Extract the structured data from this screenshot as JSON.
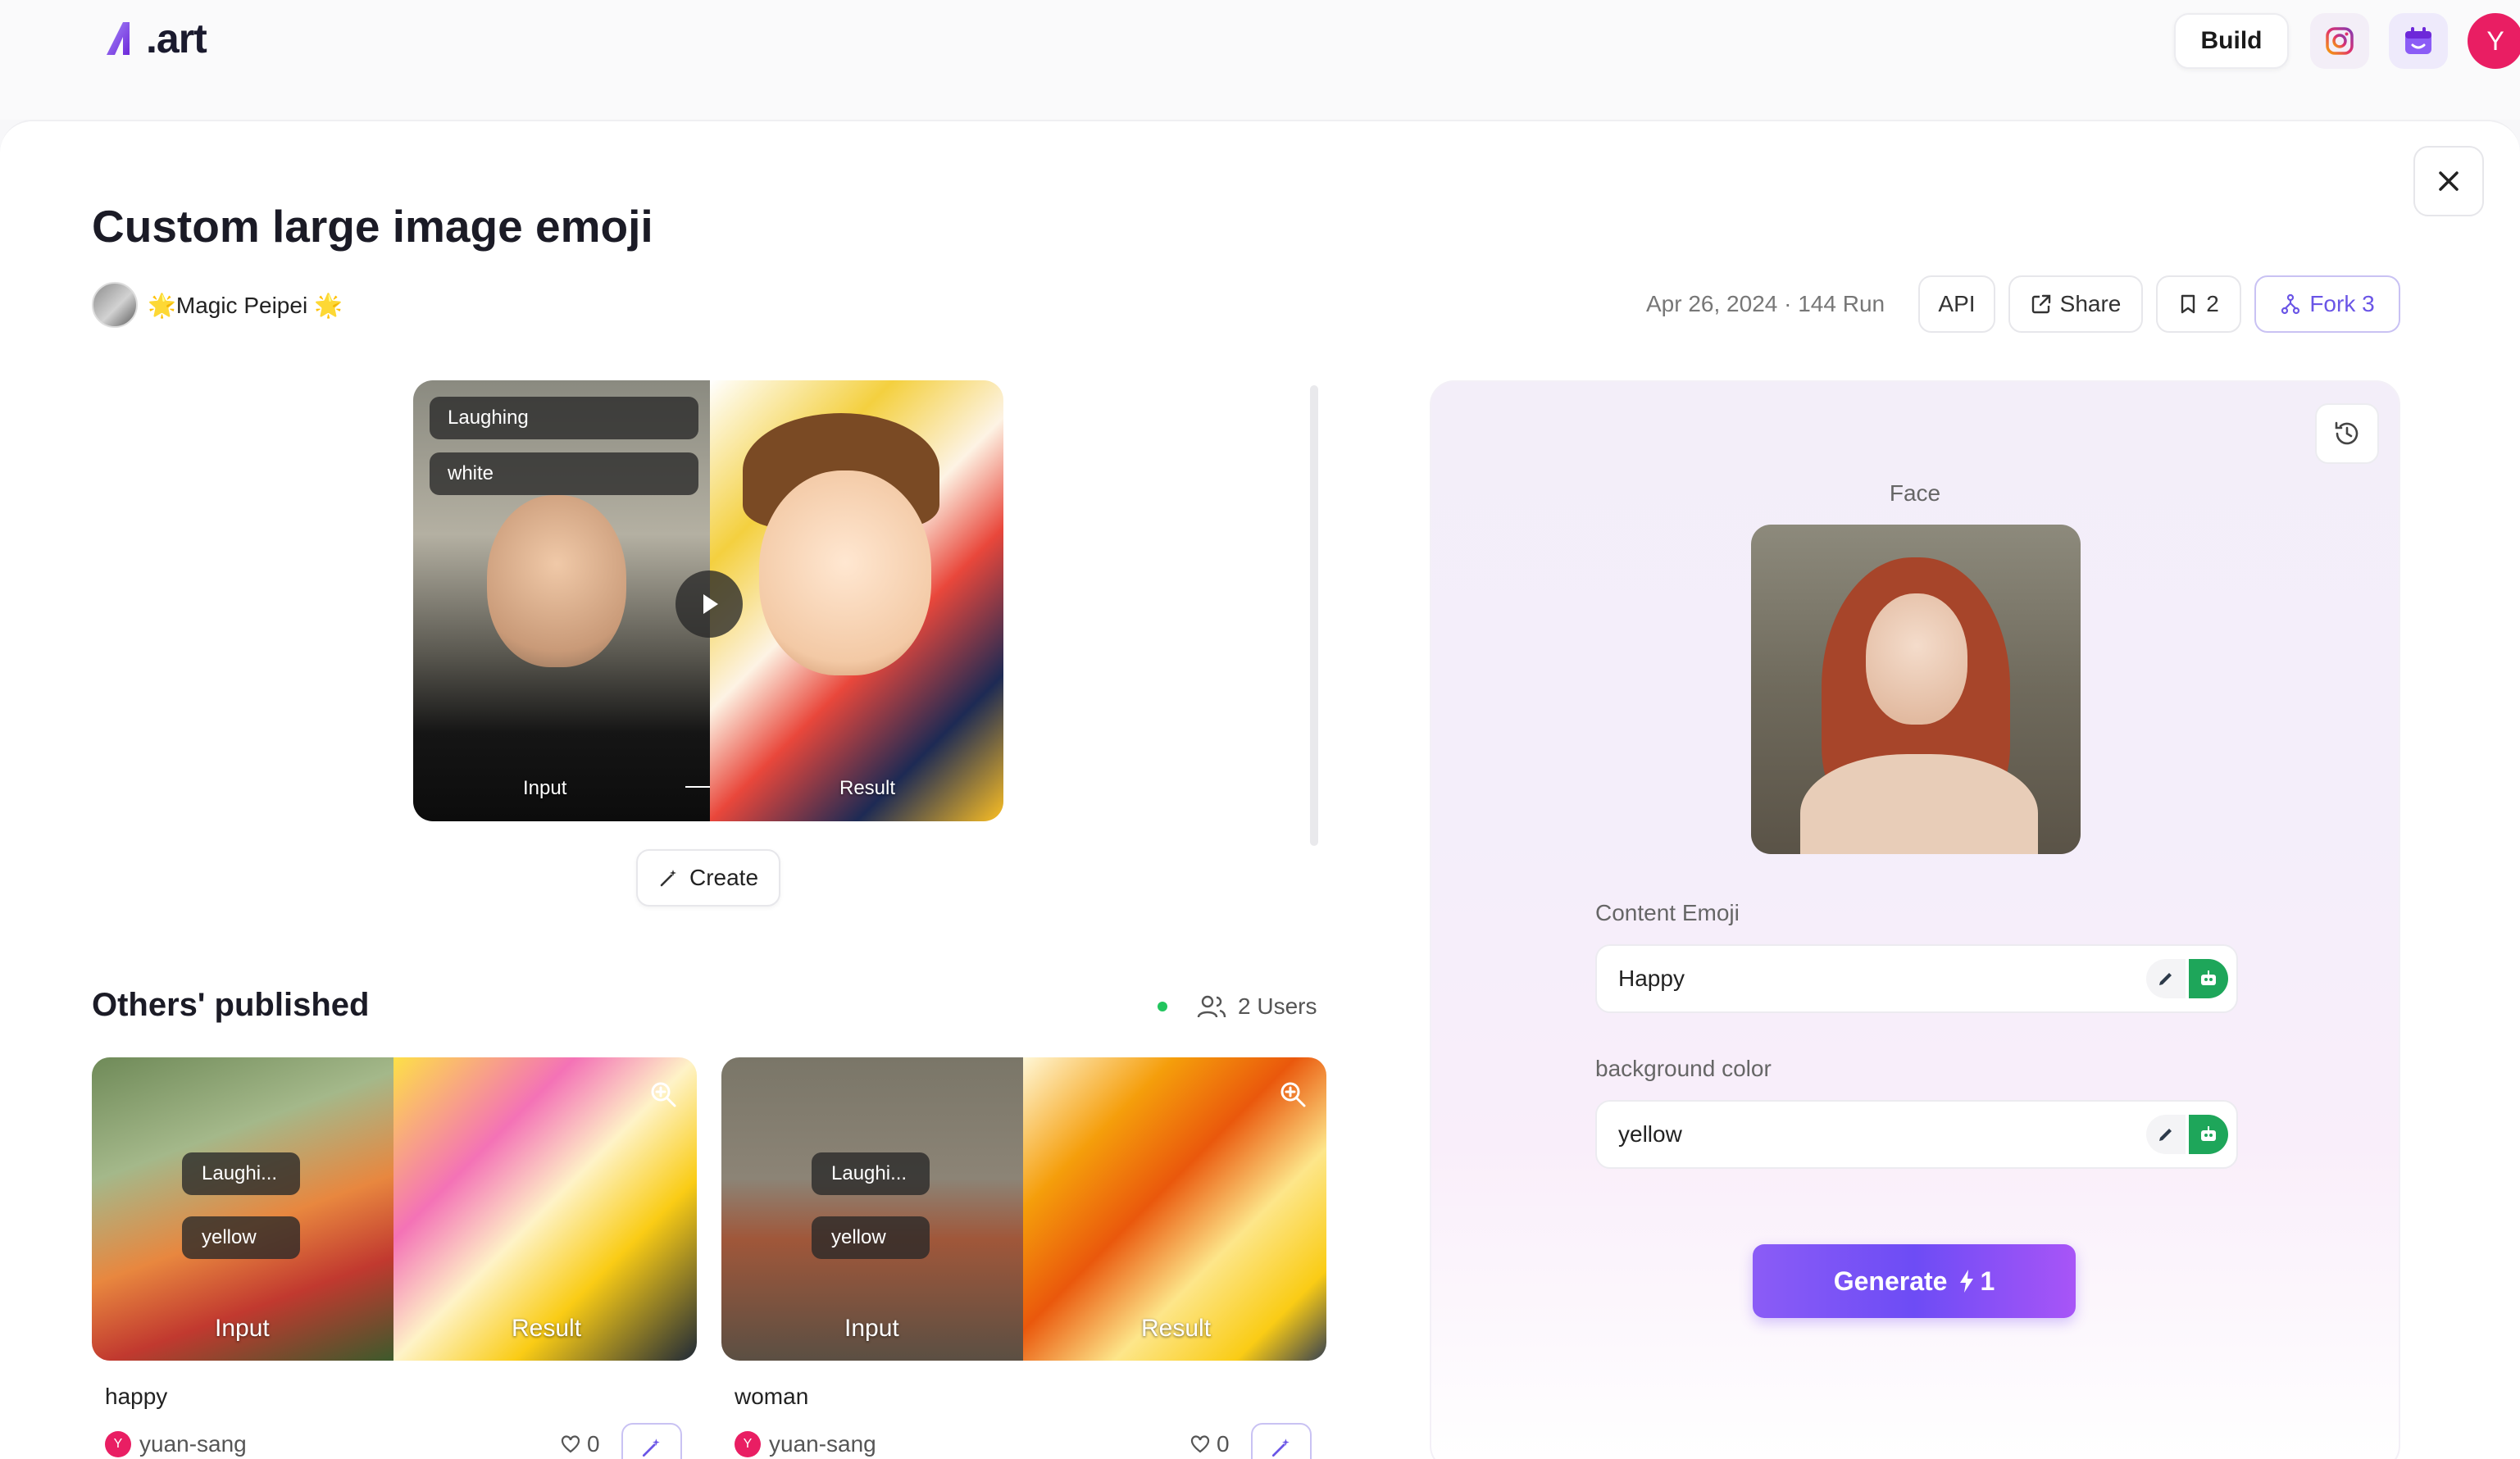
{
  "header": {
    "logo_text": ".art",
    "build_label": "Build",
    "user_initial": "Y"
  },
  "app": {
    "title": "Custom large image emoji",
    "author": "🌟Magic Peipei 🌟",
    "meta": "Apr 26, 2024 · 144 Run",
    "api_label": "API",
    "share_label": "Share",
    "bookmark_count": "2",
    "fork_label": "Fork 3"
  },
  "preview": {
    "tag1": "Laughing",
    "tag2": "white",
    "input_label": "Input",
    "result_label": "Result"
  },
  "create_label": "Create",
  "others": {
    "title": "Others' published",
    "users": "2 Users",
    "items": [
      {
        "tag1": "Laughi...",
        "tag2": "yellow",
        "input_label": "Input",
        "result_label": "Result",
        "name": "happy",
        "user": "yuan-sang",
        "user_initial": "Y",
        "likes": "0"
      },
      {
        "tag1": "Laughi...",
        "tag2": "yellow",
        "input_label": "Input",
        "result_label": "Result",
        "name": "woman",
        "user": "yuan-sang",
        "user_initial": "Y",
        "likes": "0"
      }
    ]
  },
  "form": {
    "face_label": "Face",
    "content_emoji_label": "Content Emoji",
    "content_emoji_value": "Happy",
    "bg_color_label": "background color",
    "bg_color_value": "yellow",
    "generate_label": "Generate",
    "generate_cost": "1"
  },
  "colors": {
    "accent": "#6d4cf5",
    "avatar": "#e91e63",
    "online": "#22c55e",
    "tool_green": "#1ea65a"
  },
  "icons": [
    "logo-icon",
    "instagram-icon",
    "calendar-icon",
    "close-icon",
    "share-icon",
    "bookmark-icon",
    "fork-icon",
    "play-icon",
    "wand-icon",
    "users-icon",
    "zoom-icon",
    "heart-icon",
    "history-icon",
    "pen-icon",
    "robot-icon",
    "bolt-icon",
    "arrow-icon"
  ]
}
